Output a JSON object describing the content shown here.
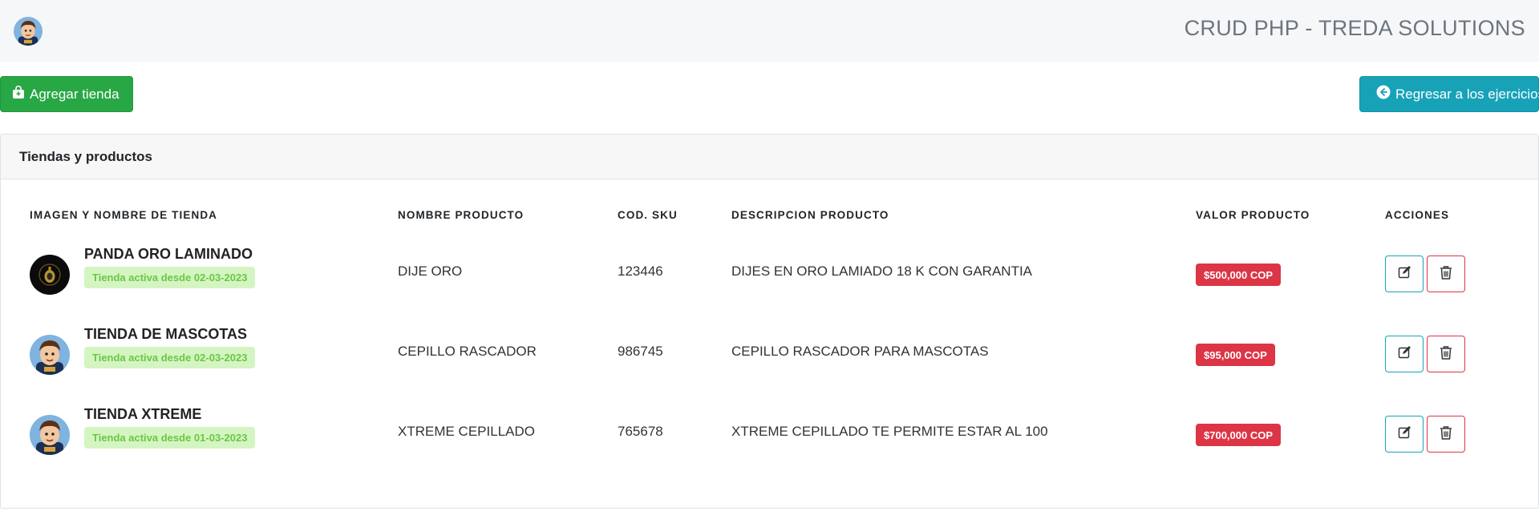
{
  "header": {
    "title": "CRUD PHP - TREDA SOLUTIONS",
    "logo_icon": "cartoon-avatar-icon"
  },
  "toolbar": {
    "add_label": "Agregar tienda",
    "add_icon": "shopping-bag-icon",
    "back_label": "Regresar a los ejercicios",
    "back_icon": "arrow-circle-left-icon"
  },
  "card": {
    "title": "Tiendas y productos"
  },
  "table": {
    "headers": [
      "IMAGEN Y NOMBRE DE TIENDA",
      "NOMBRE PRODUCTO",
      "COD. SKU",
      "DESCRIPCION PRODUCTO",
      "VALOR PRODUCTO",
      "ACCIONES"
    ],
    "rows": [
      {
        "store_name": "PANDA ORO LAMINADO",
        "store_status": "Tienda activa desde 02-03-2023",
        "store_image": "gold-pendant-icon",
        "product": "DIJE ORO",
        "sku": "123446",
        "description": "DIJES EN ORO LAMIADO 18 K CON GARANTIA",
        "price": "$500,000 COP"
      },
      {
        "store_name": "TIENDA DE MASCOTAS",
        "store_status": "Tienda activa desde 02-03-2023",
        "store_image": "cartoon-avatar-icon",
        "product": "CEPILLO RASCADOR",
        "sku": "986745",
        "description": "CEPILLO RASCADOR PARA MASCOTAS",
        "price": "$95,000 COP"
      },
      {
        "store_name": "TIENDA XTREME",
        "store_status": "Tienda activa desde 01-03-2023",
        "store_image": "cartoon-avatar-icon",
        "product": "XTREME CEPILLADO",
        "sku": "765678",
        "description": "XTREME CEPILLADO TE PERMITE ESTAR AL 100",
        "price": "$700,000 COP"
      }
    ]
  },
  "colors": {
    "success": "#28a745",
    "info": "#17a2b8",
    "danger": "#dc3545",
    "badge_bg": "#d4f5c2",
    "badge_text": "#6cc644"
  }
}
